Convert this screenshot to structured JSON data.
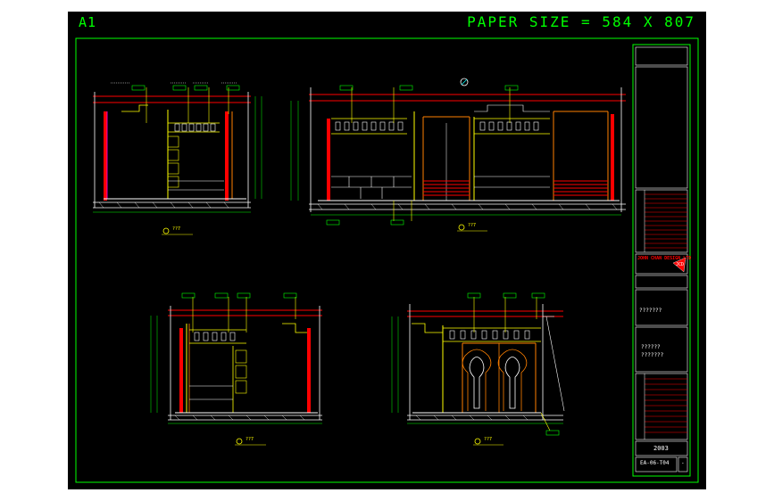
{
  "sheet": {
    "sheet_id": "A1",
    "paper_size_text": "PAPER SIZE = 584 X 807"
  },
  "title_block": {
    "company_name": "JOHN CHAN DESIGN LTD",
    "stamp": "JCD",
    "placeholder_1": "???????",
    "placeholder_2": "??????",
    "placeholder_3": "???????",
    "sheet_number": "2003",
    "drawing_number": "EA-06-T04",
    "revision": "-"
  },
  "views": [
    {
      "id": "view-top-left",
      "tag": "??7"
    },
    {
      "id": "view-top-right",
      "tag": "??7"
    },
    {
      "id": "view-bottom-left",
      "tag": "??7"
    },
    {
      "id": "view-bottom-right",
      "tag": "??7"
    }
  ],
  "colors": {
    "border": "#00ff00",
    "background": "#000000",
    "walls": "#ff0000",
    "dimension": "#ffffff",
    "highlight": "#ffff00",
    "cyan": "#00ffff",
    "orange": "#ff8000"
  }
}
